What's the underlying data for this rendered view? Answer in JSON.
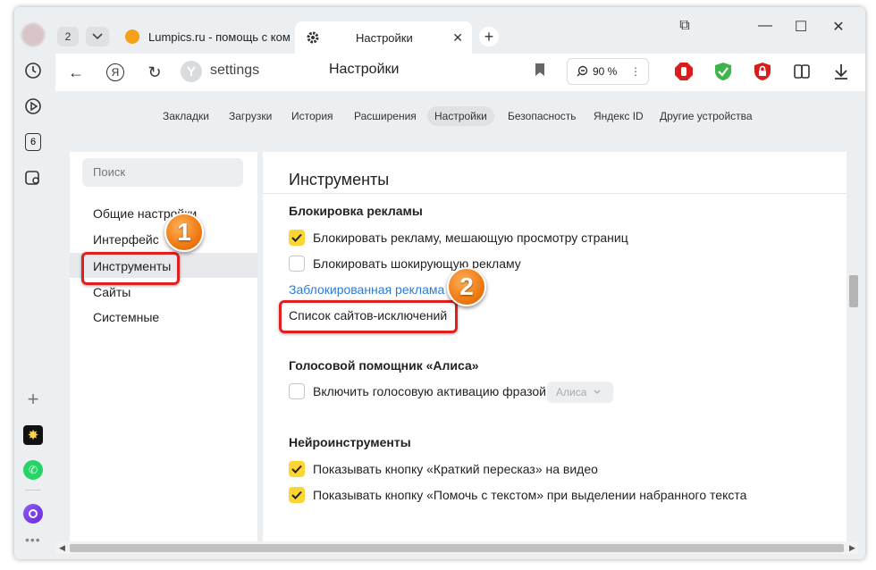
{
  "tabs": {
    "count": "2",
    "tab1_title": "Lumpics.ru - помощь с ком",
    "tab2_title": "Настройки",
    "tab2_close": "✕",
    "new_tab": "+"
  },
  "window_controls": {
    "pin": "⧉",
    "minimize": "—",
    "maximize": "☐",
    "close": "✕"
  },
  "sidebar_rail": {
    "badge_number": "6",
    "add": "+"
  },
  "address_bar": {
    "back": "←",
    "yandex": "Я",
    "reload": "↻",
    "url": "settings",
    "title": "Настройки",
    "zoom": "90 %"
  },
  "settings_nav": {
    "items": [
      "Закладки",
      "Загрузки",
      "История",
      "Расширения",
      "Настройки",
      "Безопасность",
      "Яндекс ID",
      "Другие устройства"
    ],
    "active": "Настройки"
  },
  "sidebar": {
    "search_placeholder": "Поиск",
    "items": [
      "Общие настройки",
      "Интерфейс",
      "Инструменты",
      "Сайты",
      "Системные"
    ],
    "active": "Инструменты"
  },
  "main": {
    "title": "Инструменты",
    "adblock": {
      "heading": "Блокировка рекламы",
      "options": [
        {
          "label": "Блокировать рекламу, мешающую просмотру страниц",
          "checked": true
        },
        {
          "label": "Блокировать шокирующую рекламу",
          "checked": false
        }
      ],
      "blocked_link": "Заблокированная реклама",
      "exceptions": "Список сайтов-исключений"
    },
    "alisa": {
      "heading": "Голосовой помощник «Алиса»",
      "option": "Включить голосовую активацию фразой",
      "checked": false,
      "select_value": "Алиса"
    },
    "neuro": {
      "heading": "Нейроинструменты",
      "options": [
        {
          "label": "Показывать кнопку «Краткий пересказ» на видео",
          "checked": true
        },
        {
          "label": "Показывать кнопку «Помочь с текстом» при выделении набранного текста",
          "checked": true
        }
      ]
    }
  },
  "annotations": {
    "step1": "1",
    "step2": "2"
  },
  "colors": {
    "accent_yellow": "#fdd532",
    "link": "#2a7bd8",
    "annotation_red": "#e01f1f",
    "badge_orange": "#f07a12"
  }
}
